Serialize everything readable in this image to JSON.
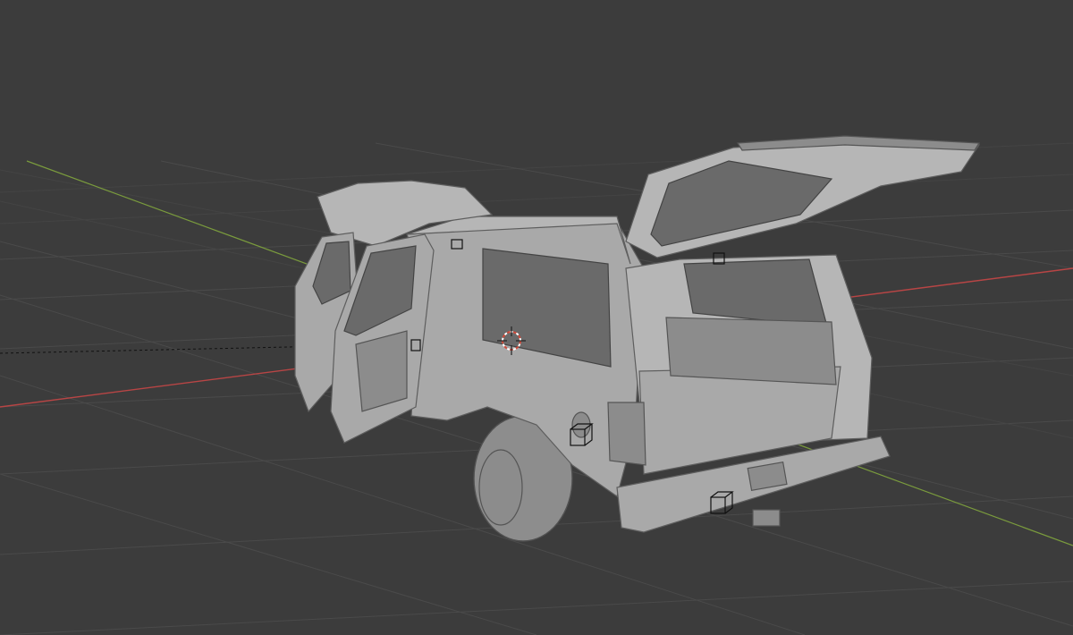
{
  "viewport": {
    "background_color": "#3c3c3c",
    "grid_color": "#4a4a4a",
    "axis_x_color": "#c44040",
    "axis_y_color": "#7aa23c",
    "scene_object": "suv-car-model",
    "cursor_icon": "3d-cursor-icon"
  }
}
